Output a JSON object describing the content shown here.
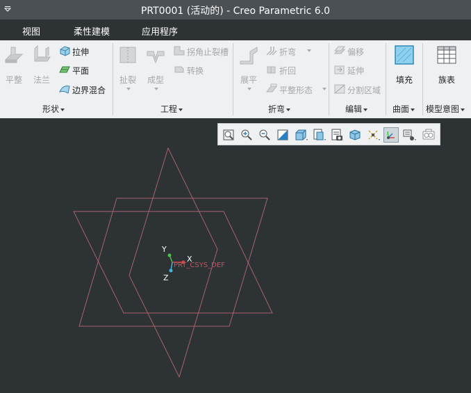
{
  "window": {
    "title": "PRT0001 (活动的) - Creo Parametric 6.0"
  },
  "menu": {
    "tabs": [
      "视图",
      "柔性建模",
      "应用程序"
    ]
  },
  "ribbon": {
    "shape": {
      "label": "形状",
      "flat_wall": "平整",
      "flange": "法兰",
      "extrude": "拉伸",
      "planar": "平面",
      "boundary_blend": "边界混合"
    },
    "engineering": {
      "label": "工程",
      "rip": "扯裂",
      "form": "成型",
      "corner_relief": "拐角止裂槽",
      "convert": "转换"
    },
    "bend": {
      "label": "折弯",
      "unbend": "展平",
      "bend": "折弯",
      "bend_back": "折回",
      "flat_pattern": "平整形态"
    },
    "editing": {
      "label": "编辑",
      "offset": "偏移",
      "extend": "延伸",
      "split_area": "分割区域"
    },
    "surfaces": {
      "label": "曲面",
      "fill": "填充"
    },
    "model_intent": {
      "label": "模型意图",
      "family_table": "族表"
    }
  },
  "graphics_toolbar": {
    "icons": [
      "refit-icon",
      "zoom-in-icon",
      "zoom-out-icon",
      "repaint-icon",
      "display-style-icon",
      "saved-orientations-icon",
      "view-manager-icon",
      "perspective-icon",
      "datum-display-icon",
      "csys-display-icon",
      "annotation-display-icon",
      "spin-center-icon"
    ]
  },
  "viewport": {
    "csys_label": "PRT_CSYS_DEF",
    "axis_x": "X",
    "axis_y": "Y",
    "axis_z": "Z",
    "datum_color": "#a8636b"
  }
}
